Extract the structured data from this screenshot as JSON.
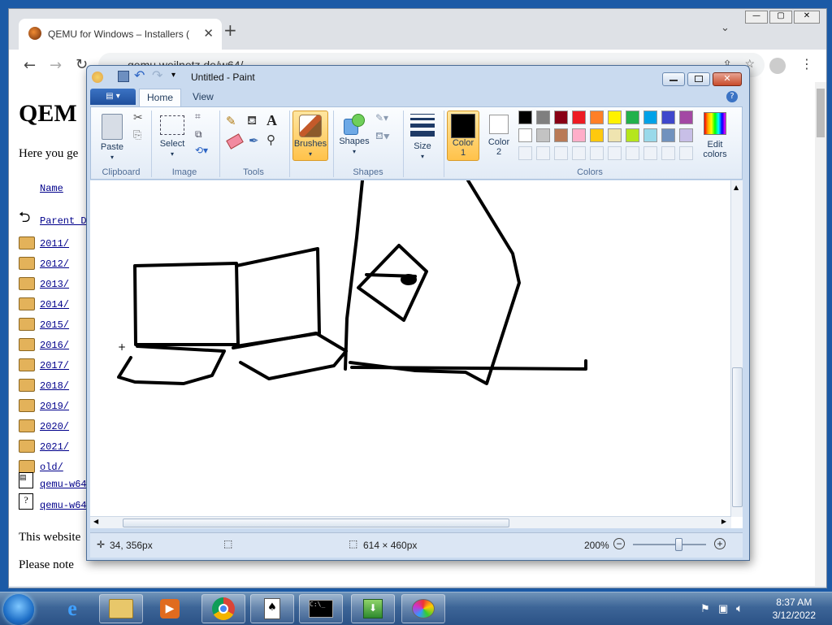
{
  "chrome": {
    "tab_title": "QEMU for Windows – Installers (",
    "url": "qemu.weilnetz.de/w64/",
    "page_heading": "QEM",
    "intro": "Here you ge",
    "col_name": "Name",
    "parent": "Parent D",
    "folders": [
      "2011/",
      "2012/",
      "2013/",
      "2014/",
      "2015/",
      "2016/",
      "2017/",
      "2018/",
      "2019/",
      "2020/",
      "2021/",
      "old/"
    ],
    "files": [
      "qemu-w64",
      "qemu-w64"
    ],
    "footer1": "This website",
    "footer2": "Please note"
  },
  "paint": {
    "title": "Untitled - Paint",
    "tabs": {
      "home": "Home",
      "view": "View"
    },
    "groups": {
      "clipboard": "Clipboard",
      "image": "Image",
      "tools": "Tools",
      "shapes": "Shapes",
      "colors": "Colors"
    },
    "buttons": {
      "paste": "Paste",
      "select": "Select",
      "brushes": "Brushes",
      "shapes": "Shapes",
      "size": "Size",
      "color1": "Color",
      "color1_n": "1",
      "color2": "Color",
      "color2_n": "2",
      "edit_colors": "Edit",
      "edit_colors2": "colors"
    },
    "palette_row1": [
      "#000000",
      "#7f7f7f",
      "#880015",
      "#ed1c24",
      "#ff7f27",
      "#fff200",
      "#22b14c",
      "#00a2e8",
      "#3f48cc",
      "#a349a4"
    ],
    "palette_row2": [
      "#ffffff",
      "#c3c3c3",
      "#b97a57",
      "#ffaec9",
      "#ffc90e",
      "#efe4b0",
      "#b5e61d",
      "#99d9ea",
      "#7092be",
      "#c8bfe7"
    ],
    "color1_value": "#000000",
    "color2_value": "#ffffff",
    "status": {
      "cursor": "34, 356px",
      "size": "614 × 460px",
      "zoom": "200%"
    },
    "zoom_level": 0.62
  },
  "taskbar": {
    "time": "8:37 AM",
    "date": "3/12/2022"
  }
}
